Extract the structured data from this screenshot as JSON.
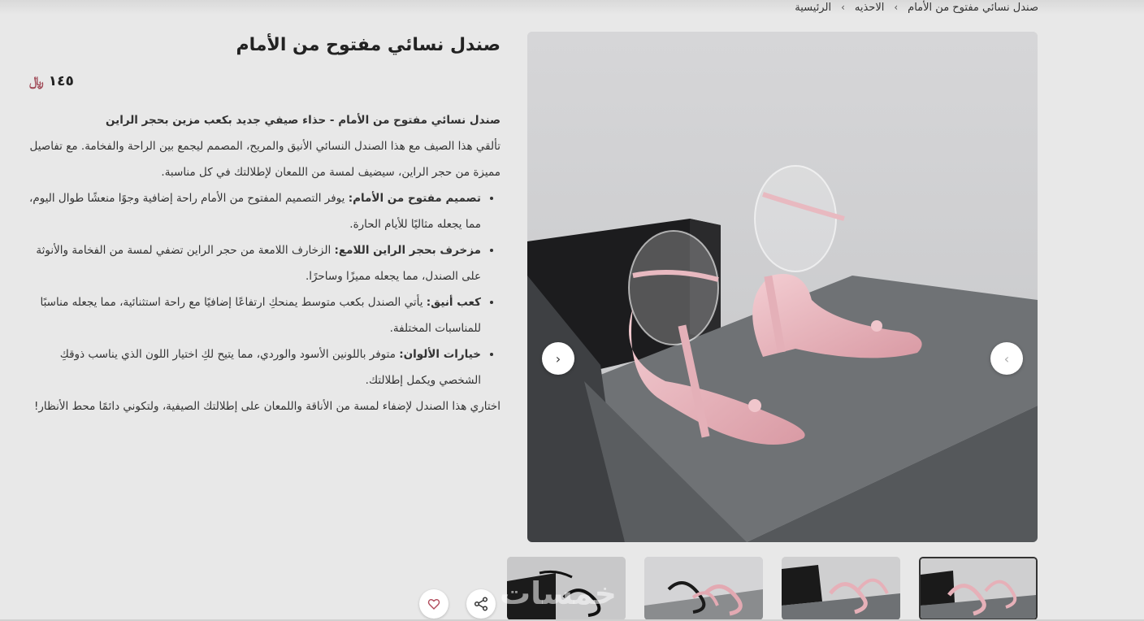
{
  "breadcrumb": {
    "home": "الرئيسية",
    "category": "الاحذيه",
    "current": "صندل نسائي مفتوح من الأمام",
    "separator": "›"
  },
  "product": {
    "title": "صندل نسائي مفتوح من الأمام",
    "price": "١٤٥",
    "currency_symbol": "﷼"
  },
  "description": {
    "lead": "صندل نسائي مفتوح من الأمام - حذاء صيفي جديد بكعب مزين بحجر الراين",
    "intro": "تألقي هذا الصيف مع هذا الصندل النسائي الأنيق والمريح، المصمم ليجمع بين الراحة والفخامة. مع تفاصيل مميزة من حجر الراين، سيضيف لمسة من اللمعان لإطلالتك في كل مناسبة.",
    "features": [
      {
        "label": "تصميم مفتوح من الأمام:",
        "text": " يوفر التصميم المفتوح من الأمام راحة إضافية وجوًا منعشًا طوال اليوم، مما يجعله مثاليًا للأيام الحارة."
      },
      {
        "label": "مزخرف بحجر الراين اللامع:",
        "text": " الزخارف اللامعة من حجر الراين تضفي لمسة من الفخامة والأنوثة على الصندل، مما يجعله مميزًا وساحرًا."
      },
      {
        "label": "كعب أنيق:",
        "text": " يأتي الصندل بكعب متوسط يمنحكِ ارتفاعًا إضافيًا مع راحة استثنائية، مما يجعله مناسبًا للمناسبات المختلفة."
      },
      {
        "label": "خيارات الألوان:",
        "text": " متوفر باللونين الأسود والوردي، مما يتيح لكِ اختيار اللون الذي يناسب ذوقكِ الشخصي ويكمل إطلالتك."
      }
    ],
    "closing": "اختاري هذا الصندل لإضفاء لمسة من الأناقة واللمعان على إطلالتك الصيفية، ولتكوني دائمًا محط الأنظار!"
  },
  "gallery": {
    "prev_icon": "chevron-left-icon",
    "next_icon": "chevron-right-icon",
    "prev_glyph": "‹",
    "next_glyph": "›"
  },
  "actions": {
    "share_icon": "share-icon",
    "favorite_icon": "heart-icon"
  },
  "watermark": "خمسات",
  "colors": {
    "background": "#e8e8e8",
    "sandal_pink": "#e9b7bd",
    "currency": "#a04a57"
  }
}
